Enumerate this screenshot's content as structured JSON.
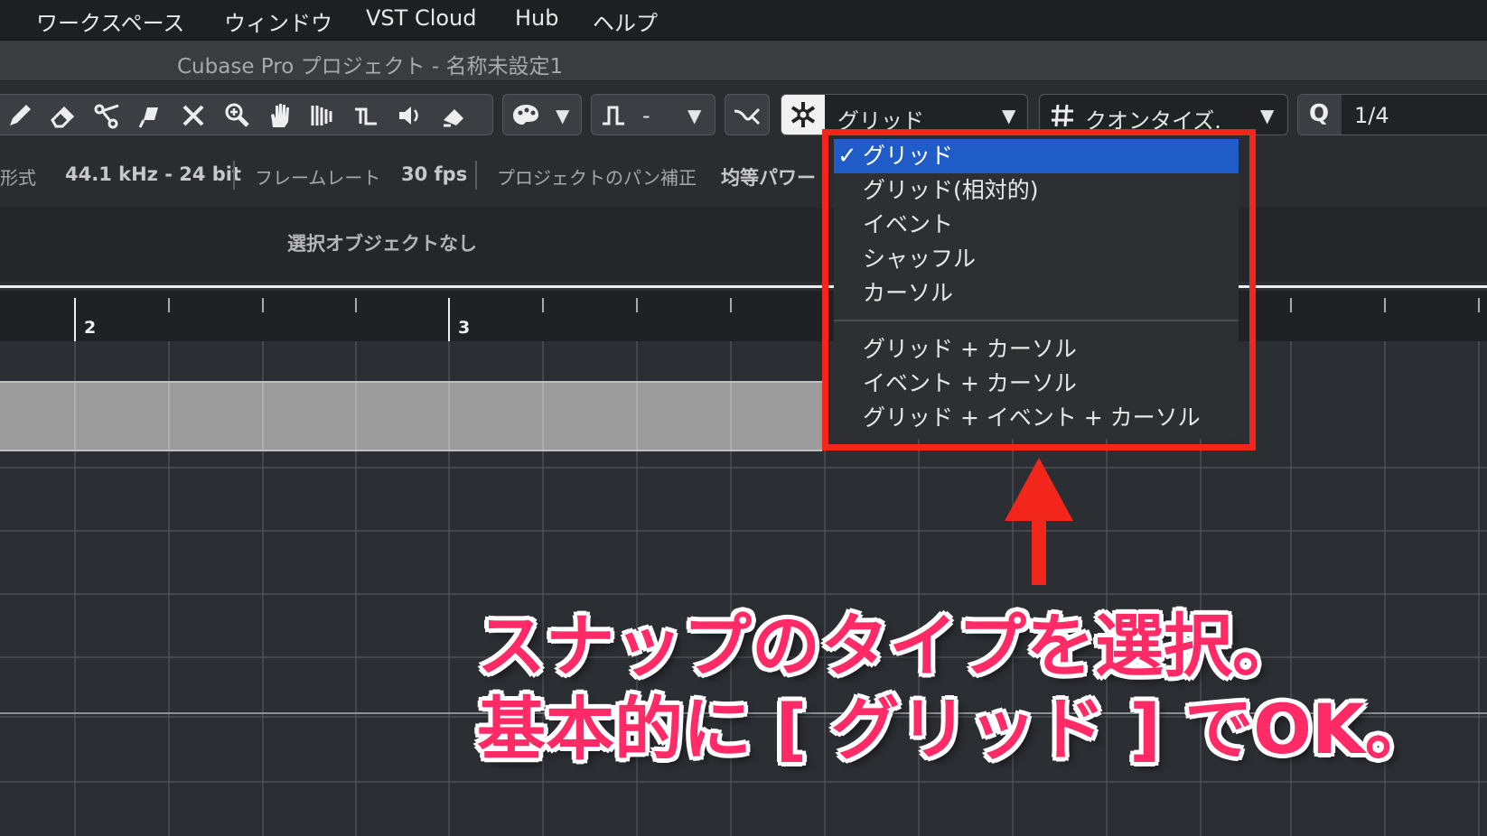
{
  "menu": {
    "items": [
      "ワークスペース",
      "ウィンドウ",
      "VST Cloud",
      "Hub",
      "ヘルプ"
    ]
  },
  "window": {
    "title": "Cubase Pro プロジェクト - 名称未設定1"
  },
  "toolbar": {
    "tools": [
      "pencil-icon",
      "eraser-icon",
      "split-scissors-icon",
      "glue-icon",
      "mute-x-icon",
      "zoom-icon",
      "hand-icon",
      "timewarp-icon",
      "comp-icon",
      "speaker-icon",
      "color-icon"
    ],
    "color_dropdown_icon": "palette-icon",
    "groove_dropdown_value": "-",
    "snap_toggle_icon": "snap-icon",
    "snap_type_value": "グリッド",
    "quantize_type_value": "クオンタイズ.",
    "quantize_label": "Q",
    "quantize_value": "1/4"
  },
  "infoline": {
    "format_label": "形式",
    "format_value": "44.1 kHz - 24 bit",
    "framerate_label": "フレームレート",
    "framerate_value": "30 fps",
    "pan_label": "プロジェクトのパン補正",
    "pan_value": "均等パワー"
  },
  "object_info": {
    "text": "選択オブジェクトなし"
  },
  "ruler": {
    "bars": [
      "2",
      "3"
    ]
  },
  "snap_menu": {
    "selected": "グリッド",
    "items_group1": [
      "グリッド",
      "グリッド(相対的)",
      "イベント",
      "シャッフル",
      "カーソル"
    ],
    "items_group2": [
      "グリッド + カーソル",
      "イベント + カーソル",
      "グリッド + イベント + カーソル"
    ]
  },
  "annotation": {
    "line1": "スナップのタイプを選択。",
    "line2": "基本的に [ グリッド ] でOK。"
  },
  "colors": {
    "highlight_red": "#f2261b",
    "annotation_pink": "#ff2a66",
    "selection_blue": "#1f5cc7"
  }
}
